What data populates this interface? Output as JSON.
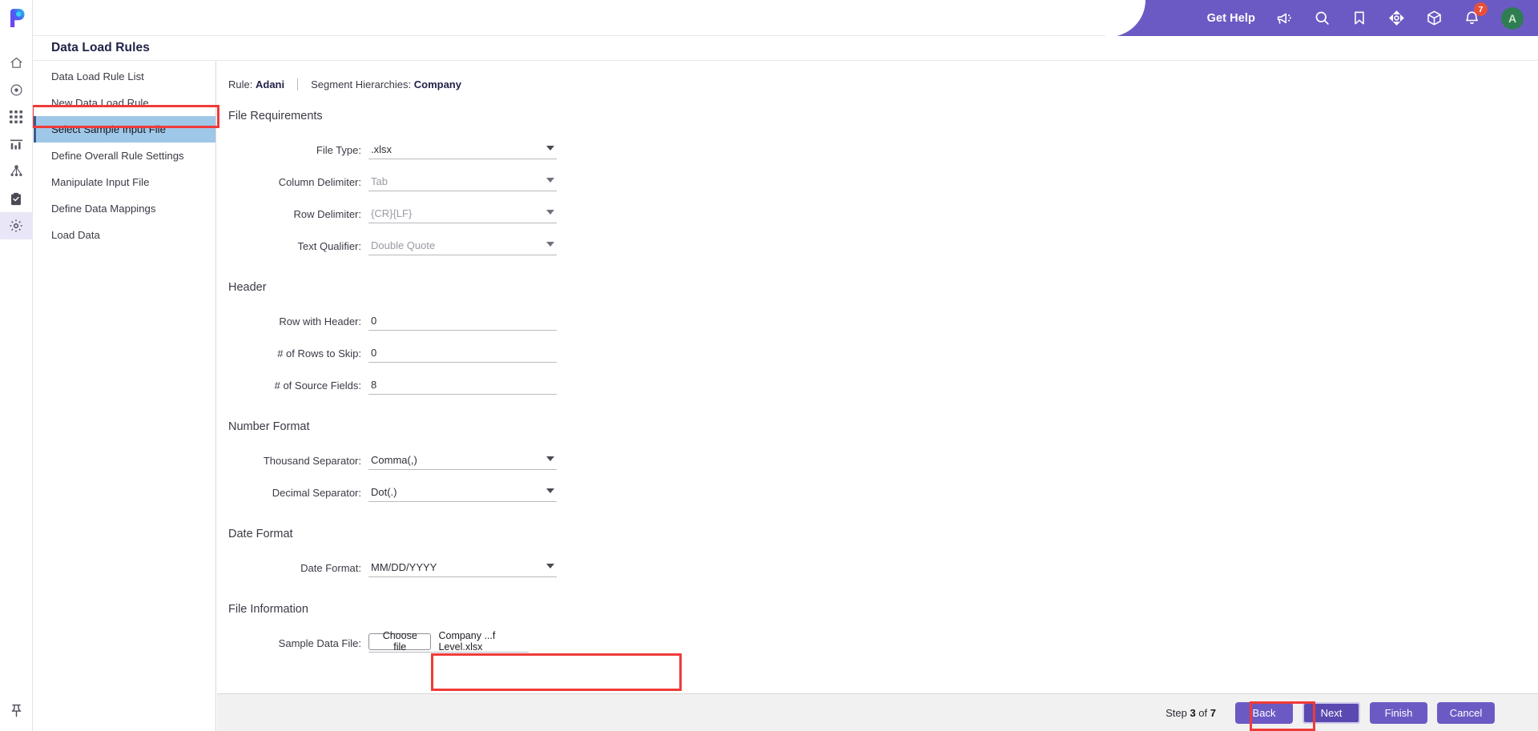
{
  "app": {
    "logo_letter": "P",
    "accent": "#6c5ac4",
    "highlight": "#ef3b38",
    "active_nav_bg": "#9fc7e8"
  },
  "rail": {
    "items": [
      {
        "name": "home-icon",
        "label": "Home"
      },
      {
        "name": "target-icon",
        "label": "Targets"
      },
      {
        "name": "grid-icon",
        "label": "Apps"
      },
      {
        "name": "chart-icon",
        "label": "Reports"
      },
      {
        "name": "hierarchy-icon",
        "label": "Hierarchy"
      },
      {
        "name": "clipboard-icon",
        "label": "Tasks"
      },
      {
        "name": "gear-icon",
        "label": "Settings"
      }
    ],
    "pin": "pin-icon"
  },
  "header": {
    "get_help": "Get Help",
    "icons": [
      "megaphone-icon",
      "search-icon",
      "bookmark-icon",
      "target-crosshair-icon",
      "cube-icon"
    ],
    "notification_count": "7",
    "avatar_initial": "A"
  },
  "page": {
    "title": "Data Load Rules"
  },
  "sidebar": {
    "items": [
      {
        "label": "Data Load Rule List",
        "active": false
      },
      {
        "label": "New Data Load Rule",
        "active": false
      },
      {
        "label": "Select Sample Input File",
        "active": true
      },
      {
        "label": "Define Overall Rule Settings",
        "active": false
      },
      {
        "label": "Manipulate Input File",
        "active": false
      },
      {
        "label": "Define Data Mappings",
        "active": false
      },
      {
        "label": "Load Data",
        "active": false
      }
    ]
  },
  "breadcrumb": {
    "rule_label": "Rule:",
    "rule_value": "Adani",
    "segment_label": "Segment Hierarchies:",
    "segment_value": "Company"
  },
  "sections": {
    "file_requirements": {
      "title": "File Requirements",
      "fields": [
        {
          "label": "File Type:",
          "value": ".xlsx",
          "muted": false,
          "dropdown": true
        },
        {
          "label": "Column Delimiter:",
          "value": "Tab",
          "muted": true,
          "dropdown": true
        },
        {
          "label": "Row Delimiter:",
          "value": "{CR}{LF}",
          "muted": true,
          "dropdown": true
        },
        {
          "label": "Text Qualifier:",
          "value": "Double Quote",
          "muted": true,
          "dropdown": true
        }
      ]
    },
    "header_section": {
      "title": "Header",
      "fields": [
        {
          "label": "Row with Header:",
          "value": "0",
          "muted": false,
          "dropdown": false
        },
        {
          "label": "# of Rows to Skip:",
          "value": "0",
          "muted": false,
          "dropdown": false
        },
        {
          "label": "# of Source Fields:",
          "value": "8",
          "muted": false,
          "dropdown": false
        }
      ]
    },
    "number_format": {
      "title": "Number Format",
      "fields": [
        {
          "label": "Thousand Separator:",
          "value": "Comma(,)",
          "muted": false,
          "dropdown": true
        },
        {
          "label": "Decimal Separator:",
          "value": "Dot(.)",
          "muted": false,
          "dropdown": true
        }
      ]
    },
    "date_format": {
      "title": "Date Format",
      "fields": [
        {
          "label": "Date Format:",
          "value": "MM/DD/YYYY",
          "muted": false,
          "dropdown": true
        }
      ]
    },
    "file_information": {
      "title": "File Information",
      "sample_data_label": "Sample Data File:",
      "choose_file_button": "Choose file",
      "chosen_file_name": "Company ...f Level.xlsx"
    }
  },
  "footer": {
    "step_prefix": "Step",
    "step_current": "3",
    "step_middle": "of",
    "step_total": "7",
    "buttons": [
      {
        "label": "Back",
        "focused": false
      },
      {
        "label": "Next",
        "focused": true
      },
      {
        "label": "Finish",
        "focused": false
      },
      {
        "label": "Cancel",
        "focused": false
      }
    ]
  }
}
